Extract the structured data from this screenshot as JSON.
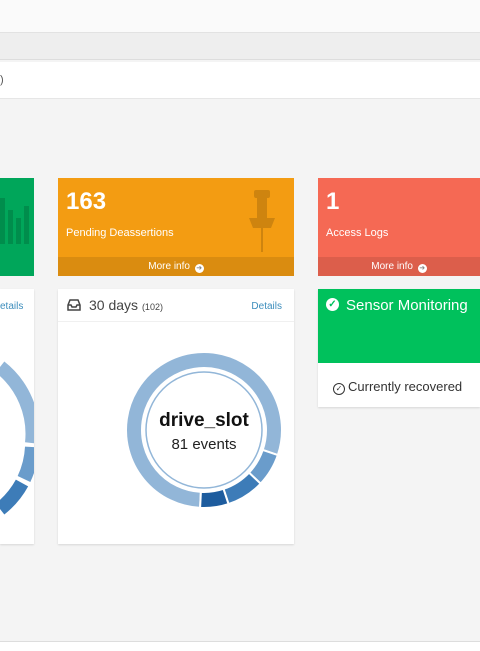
{
  "browser": {
    "url_fragment": ")"
  },
  "boxes": {
    "left": {
      "color": "#00a65a"
    },
    "pending": {
      "count": "163",
      "label": "Pending Deassertions",
      "more": "More info",
      "color": "#f39c12"
    },
    "access": {
      "count": "1",
      "label": "Access Logs",
      "more": "More info",
      "color": "#f56954"
    }
  },
  "left_panel": {
    "details": "etails"
  },
  "events_panel": {
    "title": "30 days",
    "count": "(102)",
    "details": "Details",
    "center_title": "drive_slot",
    "center_sub": "81 events"
  },
  "sensor": {
    "title": "Sensor Monitoring",
    "status": "Currently recovered",
    "color": "#00c15c"
  },
  "chart_data": {
    "type": "pie",
    "variant": "donut",
    "series": [
      {
        "label": "drive_slot",
        "value": 81,
        "color": "#92b6d8"
      },
      {
        "value": 7,
        "color": "#6a9ccb"
      },
      {
        "value": 8,
        "color": "#3d7cb8"
      },
      {
        "value": 6,
        "color": "#1d5c9e"
      }
    ],
    "title": "",
    "total": 102
  }
}
